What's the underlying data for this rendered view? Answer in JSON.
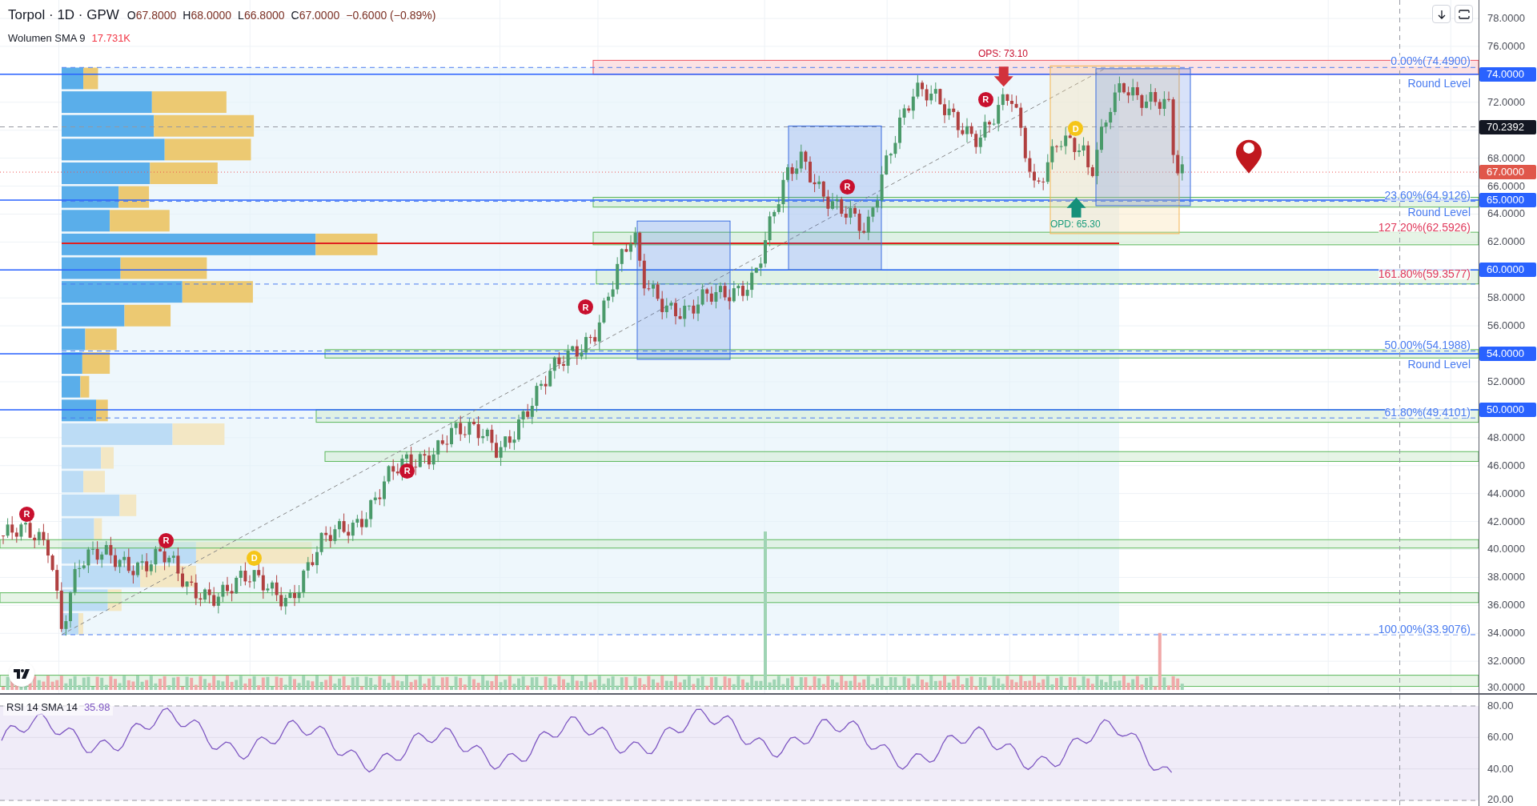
{
  "header": {
    "title": "Torpol · 1D · GPW",
    "ohlc": [
      {
        "label": "O",
        "value": "67.8000"
      },
      {
        "label": "H",
        "value": "68.0000"
      },
      {
        "label": "L",
        "value": "66.8000"
      },
      {
        "label": "C",
        "value": "67.0000"
      }
    ],
    "change": "−0.6000 (−0.89%)"
  },
  "volume_indicator": {
    "name": "Wolumen SMA 9",
    "value": "17.731K"
  },
  "markers": [
    {
      "letter": "R",
      "color": "#c8102e"
    },
    {
      "letter": "R",
      "color": "#c8102e"
    },
    {
      "letter": "D",
      "color": "#f5c518"
    },
    {
      "letter": "R",
      "color": "#c8102e"
    },
    {
      "letter": "R",
      "color": "#c8102e"
    },
    {
      "letter": "R",
      "color": "#c8102e"
    },
    {
      "letter": "R",
      "color": "#c8102e"
    },
    {
      "letter": "D",
      "color": "#f5c518"
    }
  ],
  "annotations": [
    {
      "text": "OPS: 73.10",
      "color": "#c8102e"
    },
    {
      "text": "OPD: 65.30",
      "color": "#1a9c7c"
    }
  ],
  "fib_labels": [
    {
      "text": "0.00%(74.4900)",
      "color": "#4a7cf0"
    },
    {
      "text": "23.60%(64.9126)",
      "color": "#4a7cf0"
    },
    {
      "text": "127.20%(62.5926)",
      "color": "#e03a5c"
    },
    {
      "text": "161.80%(59.3577)",
      "color": "#e03a5c"
    },
    {
      "text": "50.00%(54.1988)",
      "color": "#4a7cf0"
    },
    {
      "text": "61.80%(49.4101)",
      "color": "#4a7cf0"
    },
    {
      "text": "100.00%(33.9076)",
      "color": "#4a7cf0"
    }
  ],
  "round_levels": [
    "Round Level",
    "Round Level",
    "Round Level"
  ],
  "price_ticks": [
    "78.0000",
    "76.0000",
    "72.0000",
    "68.0000",
    "66.0000",
    "64.0000",
    "62.0000",
    "58.0000",
    "56.0000",
    "52.0000",
    "48.0000",
    "46.0000",
    "44.0000",
    "42.0000",
    "40.0000",
    "38.0000",
    "36.0000",
    "34.0000",
    "32.0000",
    "30.0000"
  ],
  "price_badges": [
    {
      "text": "74.0000",
      "kind": "level"
    },
    {
      "text": "70.2392",
      "kind": "crosshair"
    },
    {
      "text": "67.0000",
      "kind": "last"
    },
    {
      "text": "65.0000",
      "kind": "level"
    },
    {
      "text": "60.0000",
      "kind": "level"
    },
    {
      "text": "54.0000",
      "kind": "level"
    },
    {
      "text": "50.0000",
      "kind": "level"
    }
  ],
  "rsi_indicator": {
    "name": "RSI 14 SMA 14",
    "value": "35.98"
  },
  "rsi_ticks": [
    "80.00",
    "60.00",
    "40.00",
    "20.00"
  ]
}
